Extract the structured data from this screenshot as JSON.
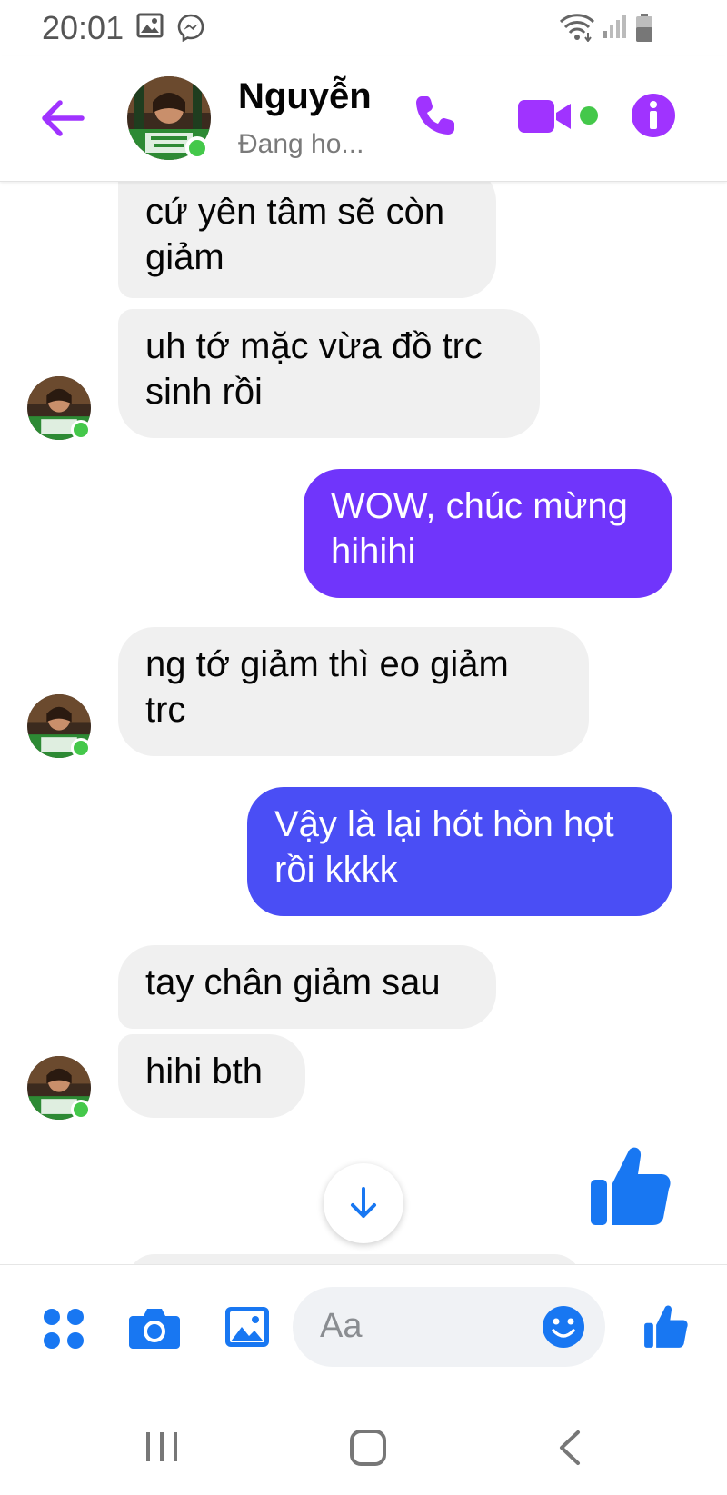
{
  "status_bar": {
    "time": "20:01",
    "icons": [
      "gallery-icon",
      "messenger-icon",
      "wifi-icon",
      "signal-icon",
      "battery-icon"
    ]
  },
  "header": {
    "contact_name": "Nguyễn",
    "contact_status": "Đang ho...",
    "icons": [
      "back-arrow-icon",
      "phone-icon",
      "video-camera-icon",
      "info-icon"
    ],
    "accent_color": "#a033ff"
  },
  "messages": [
    {
      "from": "contact",
      "text_lines": [
        "cứ yên tâm sẽ còn",
        "giảm"
      ]
    },
    {
      "from": "contact",
      "text_lines": [
        "uh tớ mặc vừa đồ trc",
        "sinh rồi"
      ]
    },
    {
      "from": "me",
      "text_lines": [
        "WOW, chúc mừng",
        "hihihi"
      ],
      "color": "#7035fb"
    },
    {
      "from": "contact",
      "text_lines": [
        "ng tớ giảm thì eo giảm",
        "trc"
      ]
    },
    {
      "from": "me",
      "text_lines": [
        "Vậy là lại hót hòn họt",
        "rồi kkkk"
      ],
      "color": "#4a4ef5"
    },
    {
      "from": "contact",
      "text_lines": [
        "tay chân giảm sau"
      ]
    },
    {
      "from": "contact",
      "text_lines": [
        "hihi bth"
      ]
    }
  ],
  "composer": {
    "placeholder": "Aa",
    "icons": [
      "apps-icon",
      "camera-icon",
      "image-icon",
      "emoji-icon",
      "like-icon"
    ],
    "accent_color": "#1877f2"
  },
  "scroll_down_icon": "arrow-down-icon",
  "big_like_icon": "thumbs-up-icon",
  "nav_bar": {
    "icons": [
      "recents-icon",
      "home-icon",
      "back-icon"
    ]
  }
}
